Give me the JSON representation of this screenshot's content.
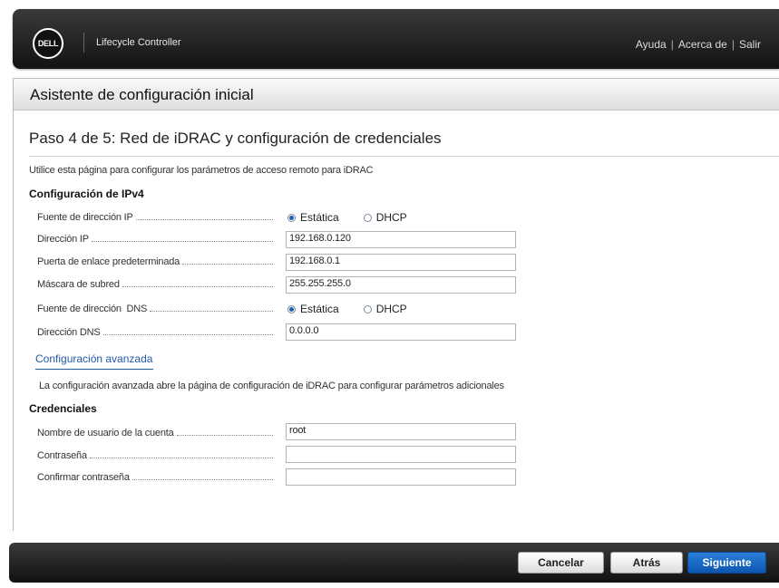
{
  "header": {
    "logo_text": "DELL",
    "app_title": "Lifecycle Controller",
    "links": [
      "Ayuda",
      "Acerca de",
      "Salir"
    ]
  },
  "wizard": {
    "title": "Asistente de configuración inicial",
    "step_title": "Paso 4 de 5: Red de iDRAC y configuración de credenciales",
    "intro": "Utilice esta página para configurar los parámetros de acceso remoto para iDRAC"
  },
  "ipv4": {
    "heading": "Configuración de IPv4",
    "ip_source_label": "Fuente de dirección IP",
    "ip_source_options": [
      "Estática",
      "DHCP"
    ],
    "ip_source_selected": "Estática",
    "ip_address_label": "Dirección IP",
    "ip_address_value": "192.168.0.120",
    "gateway_label": "Puerta de enlace predeterminada",
    "gateway_value": "192.168.0.1",
    "subnet_label": "Máscara de subred",
    "subnet_value": "255.255.255.0",
    "dns_source_label": "Fuente de dirección  DNS",
    "dns_source_options": [
      "Estática",
      "DHCP"
    ],
    "dns_source_selected": "Estática",
    "dns_label": "Dirección DNS",
    "dns_value": "0.0.0.0"
  },
  "advanced": {
    "link": "Configuración avanzada",
    "note": "La configuración avanzada abre la página de configuración de iDRAC para configurar parámetros adicionales"
  },
  "credentials": {
    "heading": "Credenciales",
    "username_label": "Nombre de usuario de la cuenta",
    "username_value": "root",
    "password_label": "Contraseña",
    "password_value": "",
    "confirm_label": "Confirmar contraseña",
    "confirm_value": ""
  },
  "footer": {
    "cancel": "Cancelar",
    "back": "Atrás",
    "next": "Siguiente"
  },
  "colors": {
    "primary_button": "#0c56b0",
    "link": "#1f5aa6",
    "radio_selected": "#1e5fb4"
  }
}
